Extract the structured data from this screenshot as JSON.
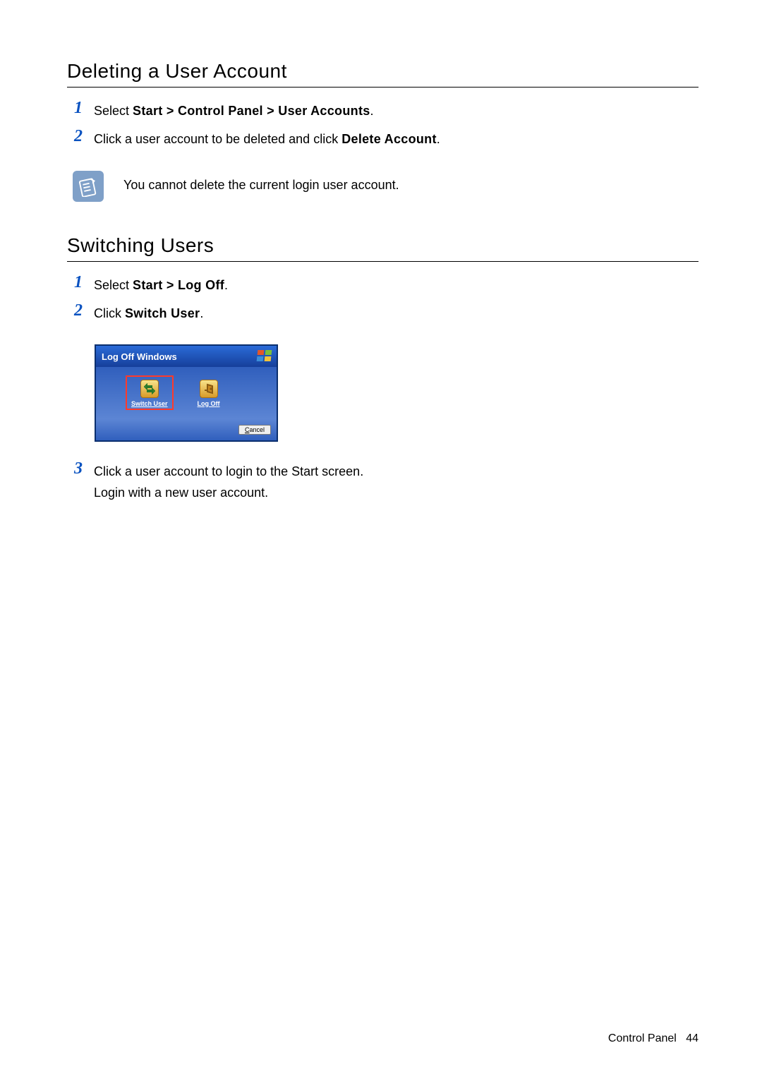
{
  "section1": {
    "heading": "Deleting a User Account",
    "steps": [
      {
        "num": "1",
        "prefix": "Select ",
        "bold": "Start > Control Panel > User Accounts",
        "suffix": "."
      },
      {
        "num": "2",
        "prefix": "Click a user account to be deleted and click ",
        "bold": "Delete Account",
        "suffix": "."
      }
    ],
    "note": "You cannot delete the current login user account."
  },
  "section2": {
    "heading": "Switching Users",
    "step1": {
      "num": "1",
      "prefix": "Select ",
      "bold": "Start > Log Off",
      "suffix": "."
    },
    "step2": {
      "num": "2",
      "prefix": "Click ",
      "bold": "Switch User",
      "suffix": "."
    },
    "dialog": {
      "title": "Log Off Windows",
      "switch_label": "Switch User",
      "logoff_label": "Log Off",
      "cancel_prefix": "C",
      "cancel_rest": "ancel"
    },
    "step3": {
      "num": "3",
      "line1": "Click a user account to login to the Start screen.",
      "line2": "Login with a new user account."
    }
  },
  "footer": {
    "section": "Control Panel",
    "page": "44"
  }
}
